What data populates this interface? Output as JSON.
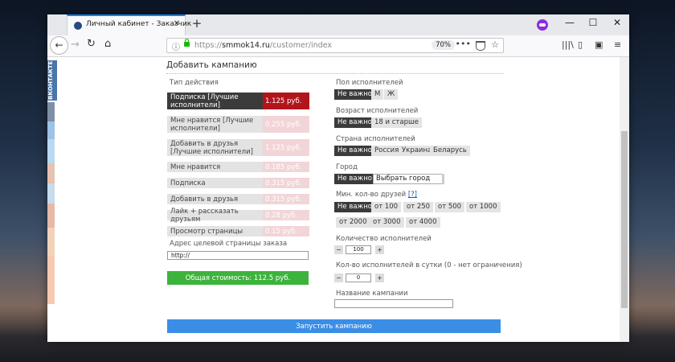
{
  "browser": {
    "tab_title": "Личный кабинет - Заказчик",
    "url_prefix": "https://",
    "url_host": "smmok14.ru",
    "url_path": "/customer/index",
    "zoom": "70%"
  },
  "social": {
    "vk_label": "ВКОНТАКТЕ"
  },
  "page": {
    "title": "Добавить кампанию",
    "action_type_label": "Тип действия",
    "plans": [
      {
        "name": "Подписка [Лучшие исполнители]",
        "price": "1.125 руб.",
        "selected": true
      },
      {
        "name": "Мне нравится [Лучшие исполнители]",
        "price": "0.255 руб.",
        "selected": false
      },
      {
        "name": "Добавить в друзья [Лучшие исполнители]",
        "price": "1.125 руб.",
        "selected": false
      },
      {
        "name": "Мне нравится",
        "price": "0.185 руб.",
        "selected": false
      },
      {
        "name": "Подписка",
        "price": "0.315 руб.",
        "selected": false
      },
      {
        "name": "Добавить в друзья",
        "price": "0.315 руб.",
        "selected": false
      },
      {
        "name": "Лайк + рассказать друзьям",
        "price": "0.28 руб.",
        "selected": false
      },
      {
        "name": "Просмотр страницы",
        "price": "0.15 руб.",
        "selected": false
      }
    ],
    "target_url_label": "Адрес целевой страницы заказа",
    "target_url_value": "http://",
    "total_label": "Общая стоимость: 112.5 руб.",
    "gender": {
      "label": "Пол исполнителей",
      "options": [
        "Не важно",
        "М",
        "Ж"
      ]
    },
    "age": {
      "label": "Возраст исполнителей",
      "options": [
        "Не важно",
        "18 и старше"
      ]
    },
    "country": {
      "label": "Страна исполнителей",
      "options": [
        "Не важно",
        "Россия",
        "Украина",
        "Беларусь"
      ]
    },
    "city": {
      "label": "Город",
      "options": [
        "Не важно"
      ],
      "select_value": "Выбрать город"
    },
    "friends": {
      "label": "Мин. кол-во друзей",
      "help": "[?]",
      "options": [
        "Не важно",
        "от 100",
        "от 250",
        "от 500",
        "от 1000",
        "от 2000",
        "от 3000",
        "от 4000"
      ]
    },
    "executors": {
      "label": "Количество исполнителей",
      "minus": "−",
      "value": "100",
      "plus": "+"
    },
    "daily": {
      "label": "Кол-во исполнителей в сутки (0 - нет ограничения)",
      "minus": "−",
      "value": "0",
      "plus": "+"
    },
    "campaign_name_label": "Название кампании",
    "campaign_name_value": "",
    "launch_label": "Запустить кампанию"
  }
}
